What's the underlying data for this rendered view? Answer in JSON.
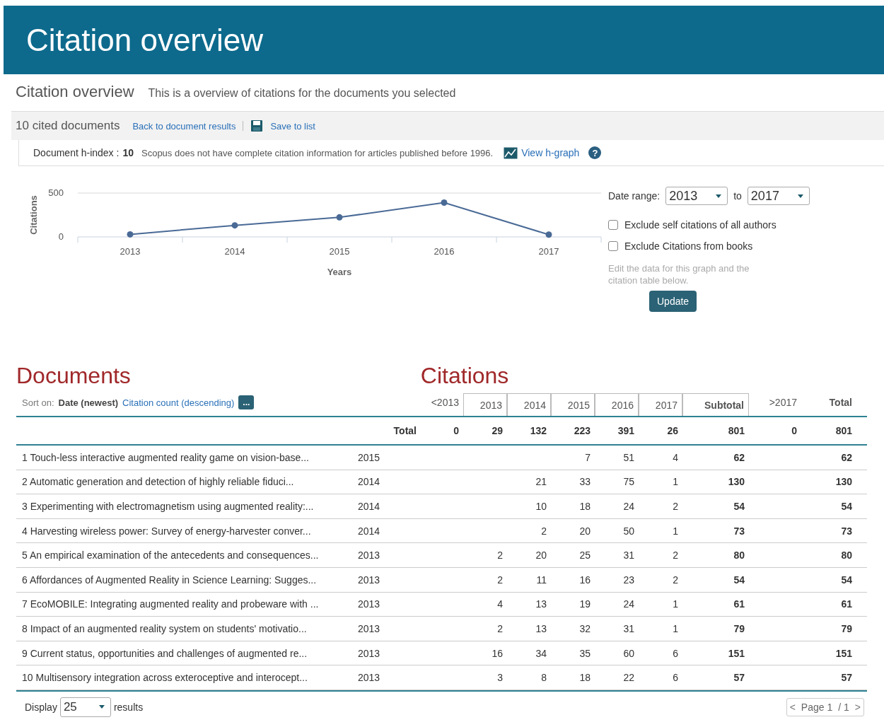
{
  "banner": {
    "title": "Citation overview"
  },
  "heading": {
    "title": "Citation overview",
    "subtitle": "This is a overview of citations for the documents you selected"
  },
  "toolbar": {
    "count": "10 cited documents",
    "links": [
      "Back to document results",
      "Save to list"
    ]
  },
  "info_bar": {
    "label": "Document h-index :",
    "value": "10",
    "note": "Scopus does not have complete citation information for articles published before 1996.",
    "link": "View h-graph",
    "help": "?"
  },
  "chart": {
    "chart_data": {
      "type": "line",
      "xlabel": "Years",
      "ylabel": "Citations",
      "categories": [
        "2013",
        "2014",
        "2015",
        "2016",
        "2017"
      ],
      "series": [
        {
          "color": "#4a6a96",
          "marker": "circle",
          "values": [
            29,
            132,
            223,
            391,
            26
          ]
        }
      ],
      "ylim": [
        0,
        500
      ],
      "yticks": [
        0,
        500
      ]
    }
  },
  "filters": {
    "date_label": "Date range:",
    "from": "2013",
    "to_label": "to",
    "to": "2017",
    "options": [
      {
        "label": "Exclude self citations of all authors",
        "checked": false
      },
      {
        "label": "Exclude Citations from books",
        "checked": false
      }
    ],
    "hint": "Edit the data for this graph and the citation table below.",
    "button": "Update"
  },
  "documents_title": "Documents",
  "citations_title": "Citations",
  "sort": {
    "label": "Sort on:",
    "options": [
      {
        "label": "Date (newest)",
        "selected": true
      },
      {
        "label": "Citation count (descending)",
        "selected": false
      }
    ],
    "more": "..."
  },
  "columns": [
    {
      "label": "<2013",
      "kind": "outside"
    },
    {
      "label": "2013",
      "kind": "year"
    },
    {
      "label": "2014",
      "kind": "year"
    },
    {
      "label": "2015",
      "kind": "year"
    },
    {
      "label": "2016",
      "kind": "year"
    },
    {
      "label": "2017",
      "kind": "year"
    },
    {
      "label": "Subtotal",
      "kind": "subtotal"
    },
    {
      "label": ">2017",
      "kind": "outside"
    },
    {
      "label": "Total",
      "kind": "total"
    }
  ],
  "totals": {
    "label": "Total",
    "values": [
      "0",
      "29",
      "132",
      "223",
      "391",
      "26",
      "801",
      "0",
      "801"
    ]
  },
  "rows": [
    {
      "number": "1",
      "title": "Touch-less interactive augmented reality game on vision-base...",
      "year": "2015",
      "years": [
        "7",
        "51",
        "4"
      ],
      "subtotal": "62",
      "total": "62"
    },
    {
      "number": "2",
      "title": "Automatic generation and detection of highly reliable fiduci...",
      "year": "2014",
      "years": [
        "21",
        "33",
        "75",
        "1"
      ],
      "subtotal": "130",
      "total": "130"
    },
    {
      "number": "3",
      "title": "Experimenting with electromagnetism using augmented reality:...",
      "year": "2014",
      "years": [
        "10",
        "18",
        "24",
        "2"
      ],
      "subtotal": "54",
      "total": "54"
    },
    {
      "number": "4",
      "title": "Harvesting wireless power: Survey of energy-harvester conver...",
      "year": "2014",
      "years": [
        "2",
        "20",
        "50",
        "1"
      ],
      "subtotal": "73",
      "total": "73"
    },
    {
      "number": "5",
      "title": "An empirical examination of the antecedents and consequences...",
      "year": "2013",
      "years": [
        "2",
        "20",
        "25",
        "31",
        "2"
      ],
      "subtotal": "80",
      "total": "80"
    },
    {
      "number": "6",
      "title": "Affordances of Augmented Reality in Science Learning: Sugges...",
      "year": "2013",
      "years": [
        "2",
        "11",
        "16",
        "23",
        "2"
      ],
      "subtotal": "54",
      "total": "54"
    },
    {
      "number": "7",
      "title": "EcoMOBILE: Integrating augmented reality and probeware with ...",
      "year": "2013",
      "years": [
        "4",
        "13",
        "19",
        "24",
        "1"
      ],
      "subtotal": "61",
      "total": "61"
    },
    {
      "number": "8",
      "title": "Impact of an augmented reality system on students' motivatio...",
      "year": "2013",
      "years": [
        "2",
        "13",
        "32",
        "31",
        "1"
      ],
      "subtotal": "79",
      "total": "79"
    },
    {
      "number": "9",
      "title": "Current status, opportunities and challenges of augmented re...",
      "year": "2013",
      "years": [
        "16",
        "34",
        "35",
        "60",
        "6"
      ],
      "subtotal": "151",
      "total": "151"
    },
    {
      "number": "10",
      "title": "Multisensory integration across exteroceptive and interocept...",
      "year": "2013",
      "years": [
        "3",
        "8",
        "18",
        "22",
        "6"
      ],
      "subtotal": "57",
      "total": "57"
    }
  ],
  "footer": {
    "display_label": "Display",
    "page_size": "25",
    "results_label": "results",
    "page": "Page 1",
    "of": "/ 1",
    "prev": "<",
    "next": ">"
  }
}
